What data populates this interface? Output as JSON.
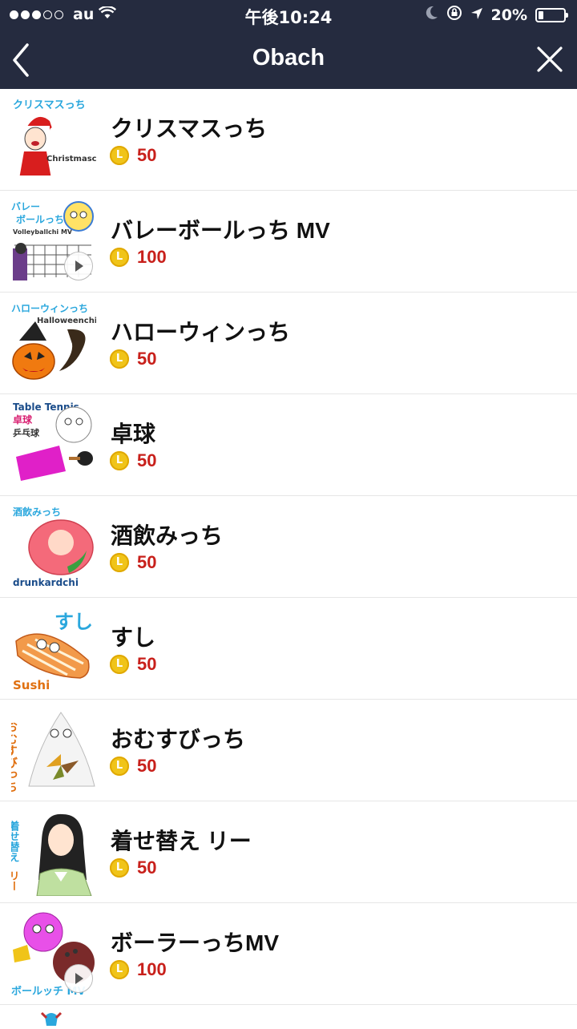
{
  "status_bar": {
    "carrier": "au",
    "time": "午後10:24",
    "battery": "20%",
    "battery_level": 0.2
  },
  "nav": {
    "title": "Obach",
    "back_icon": "chevron-left-icon",
    "close_icon": "close-icon"
  },
  "items": [
    {
      "title": "クリスマスっち",
      "price": "50",
      "thumb_text": [
        "クリスマスっち",
        "Christmaschi"
      ]
    },
    {
      "title": "バレーボールっち MV",
      "price": "100",
      "thumb_text": [
        "バレー",
        "ボールっち",
        "Volleyballchi MV"
      ]
    },
    {
      "title": "ハローウィンっち",
      "price": "50",
      "thumb_text": [
        "ハローウィンっち",
        "Halloweenchi"
      ]
    },
    {
      "title": "卓球",
      "price": "50",
      "thumb_text": [
        "Table Tennis",
        "卓球",
        "乒乓球"
      ]
    },
    {
      "title": "酒飲みっち",
      "price": "50",
      "thumb_text": [
        "酒飲みっち",
        "drunkardchi"
      ]
    },
    {
      "title": "すし",
      "price": "50",
      "thumb_text": [
        "すし",
        "Sushi"
      ]
    },
    {
      "title": "おむすびっち",
      "price": "50",
      "thumb_text": [
        "おむすびっち"
      ]
    },
    {
      "title": "着せ替え リー",
      "price": "50",
      "thumb_text": [
        "着せ替え",
        "リー"
      ]
    },
    {
      "title": "ボーラーっちMV",
      "price": "100",
      "thumb_text": [
        "ボールッチ MV"
      ]
    }
  ]
}
